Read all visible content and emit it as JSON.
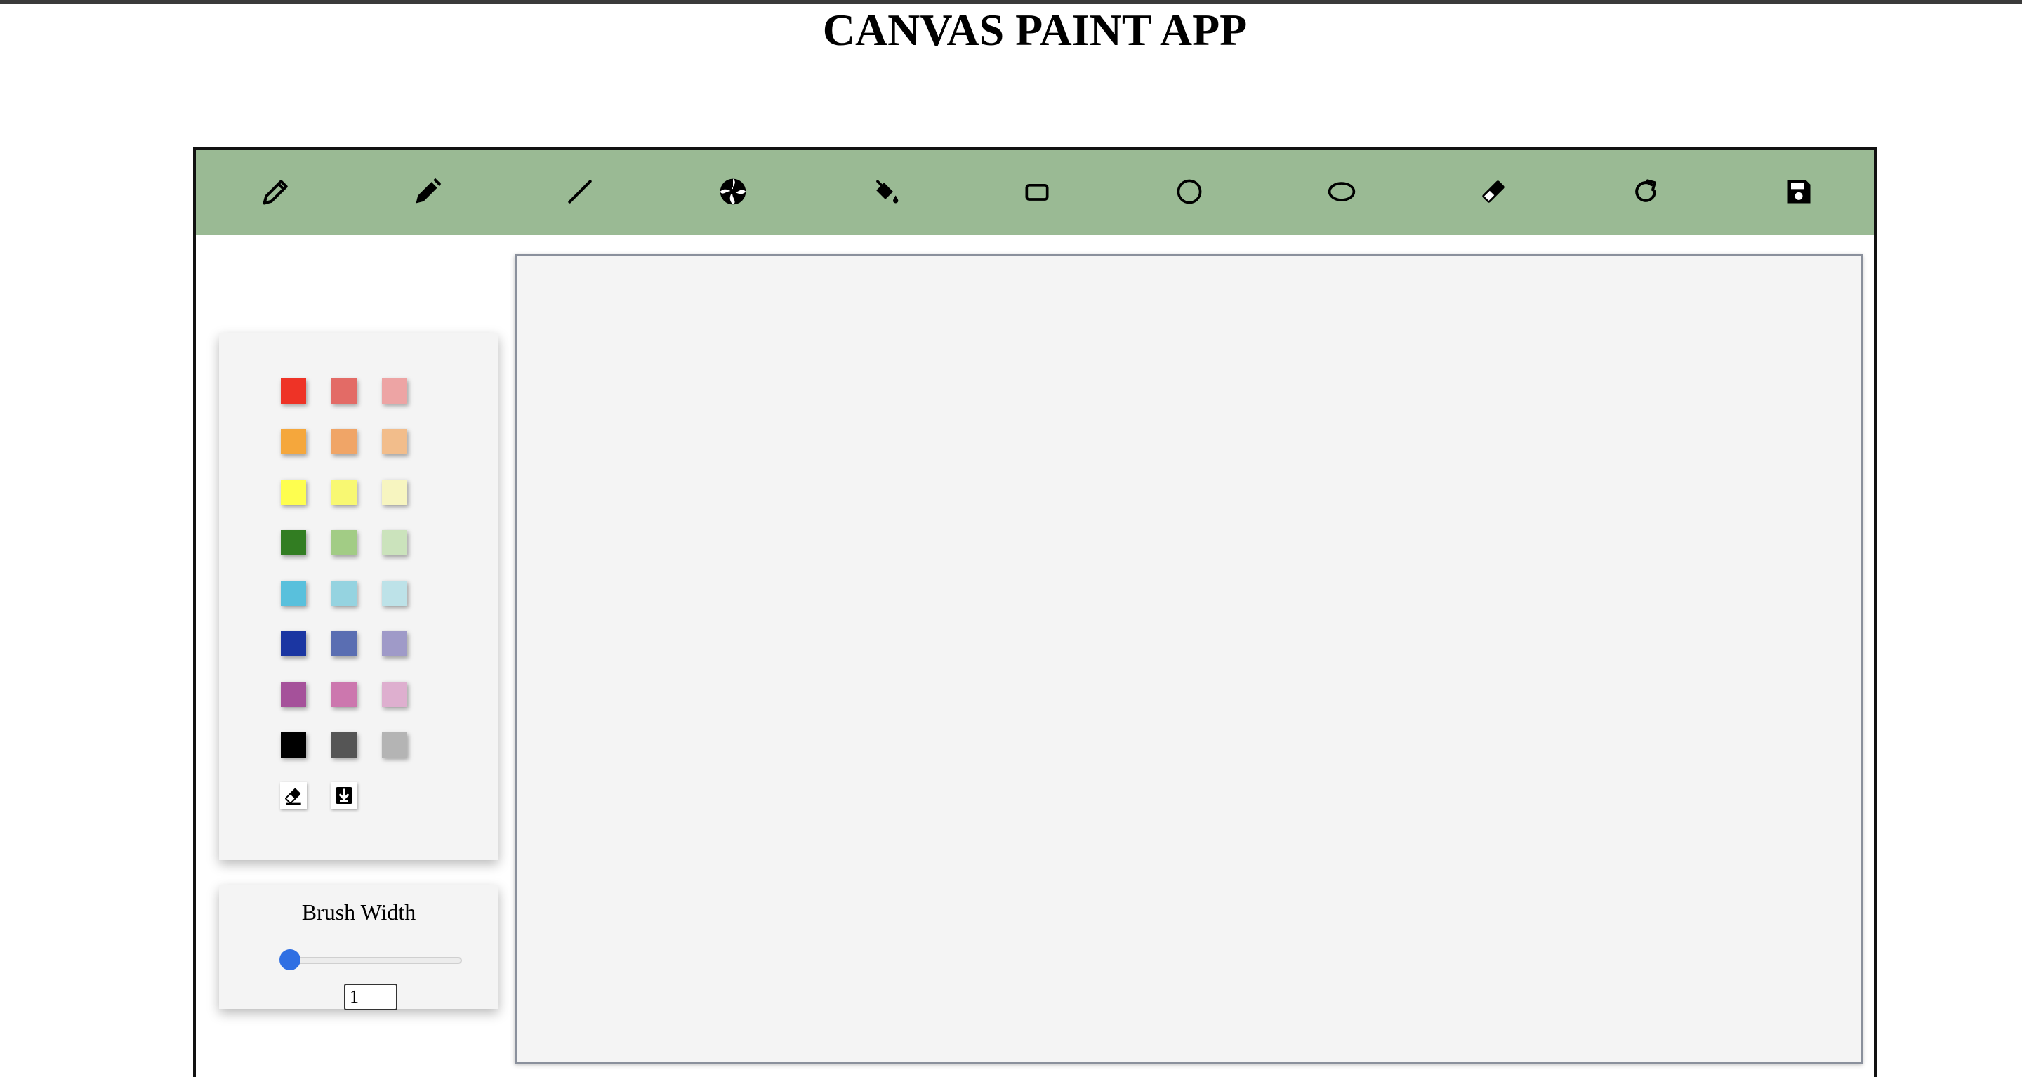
{
  "title": "CANVAS PAINT APP",
  "toolbar": {
    "tools": [
      {
        "name": "pencil",
        "icon": "pencil-icon"
      },
      {
        "name": "brush",
        "icon": "marker-icon"
      },
      {
        "name": "line",
        "icon": "line-icon"
      },
      {
        "name": "spray",
        "icon": "spray-icon"
      },
      {
        "name": "fill",
        "icon": "fill-bucket-icon"
      },
      {
        "name": "rectangle",
        "icon": "rectangle-icon"
      },
      {
        "name": "circle",
        "icon": "circle-icon"
      },
      {
        "name": "ellipse",
        "icon": "ellipse-icon"
      },
      {
        "name": "eraser",
        "icon": "eraser-icon"
      },
      {
        "name": "undo",
        "icon": "rotate-icon"
      },
      {
        "name": "save",
        "icon": "floppy-disk-icon"
      }
    ],
    "background_color": "#9aba94"
  },
  "palette": {
    "colors": [
      [
        "#ee3326",
        "#e36b66",
        "#eda4a4"
      ],
      [
        "#f5a73c",
        "#f0a567",
        "#f2bd8b"
      ],
      [
        "#fefe4f",
        "#f8f872",
        "#f7f5c0"
      ],
      [
        "#327d22",
        "#a2cc85",
        "#cbe3bc"
      ],
      [
        "#59c0dc",
        "#95d3e0",
        "#bde2e8"
      ],
      [
        "#1b36a2",
        "#5a6eb2",
        "#9f9ac8"
      ],
      [
        "#a5519a",
        "#cc77ae",
        "#deafcf"
      ],
      [
        "#000000",
        "#555555",
        "#b4b4b4"
      ]
    ],
    "utility_buttons": [
      {
        "name": "clear-color",
        "icon": "eraser-icon"
      },
      {
        "name": "custom-color",
        "icon": "download-icon"
      }
    ]
  },
  "brush_width": {
    "label": "Brush Width",
    "value": "1",
    "min": 1,
    "max": 100
  },
  "canvas": {
    "background_color": "#f4f4f4"
  }
}
